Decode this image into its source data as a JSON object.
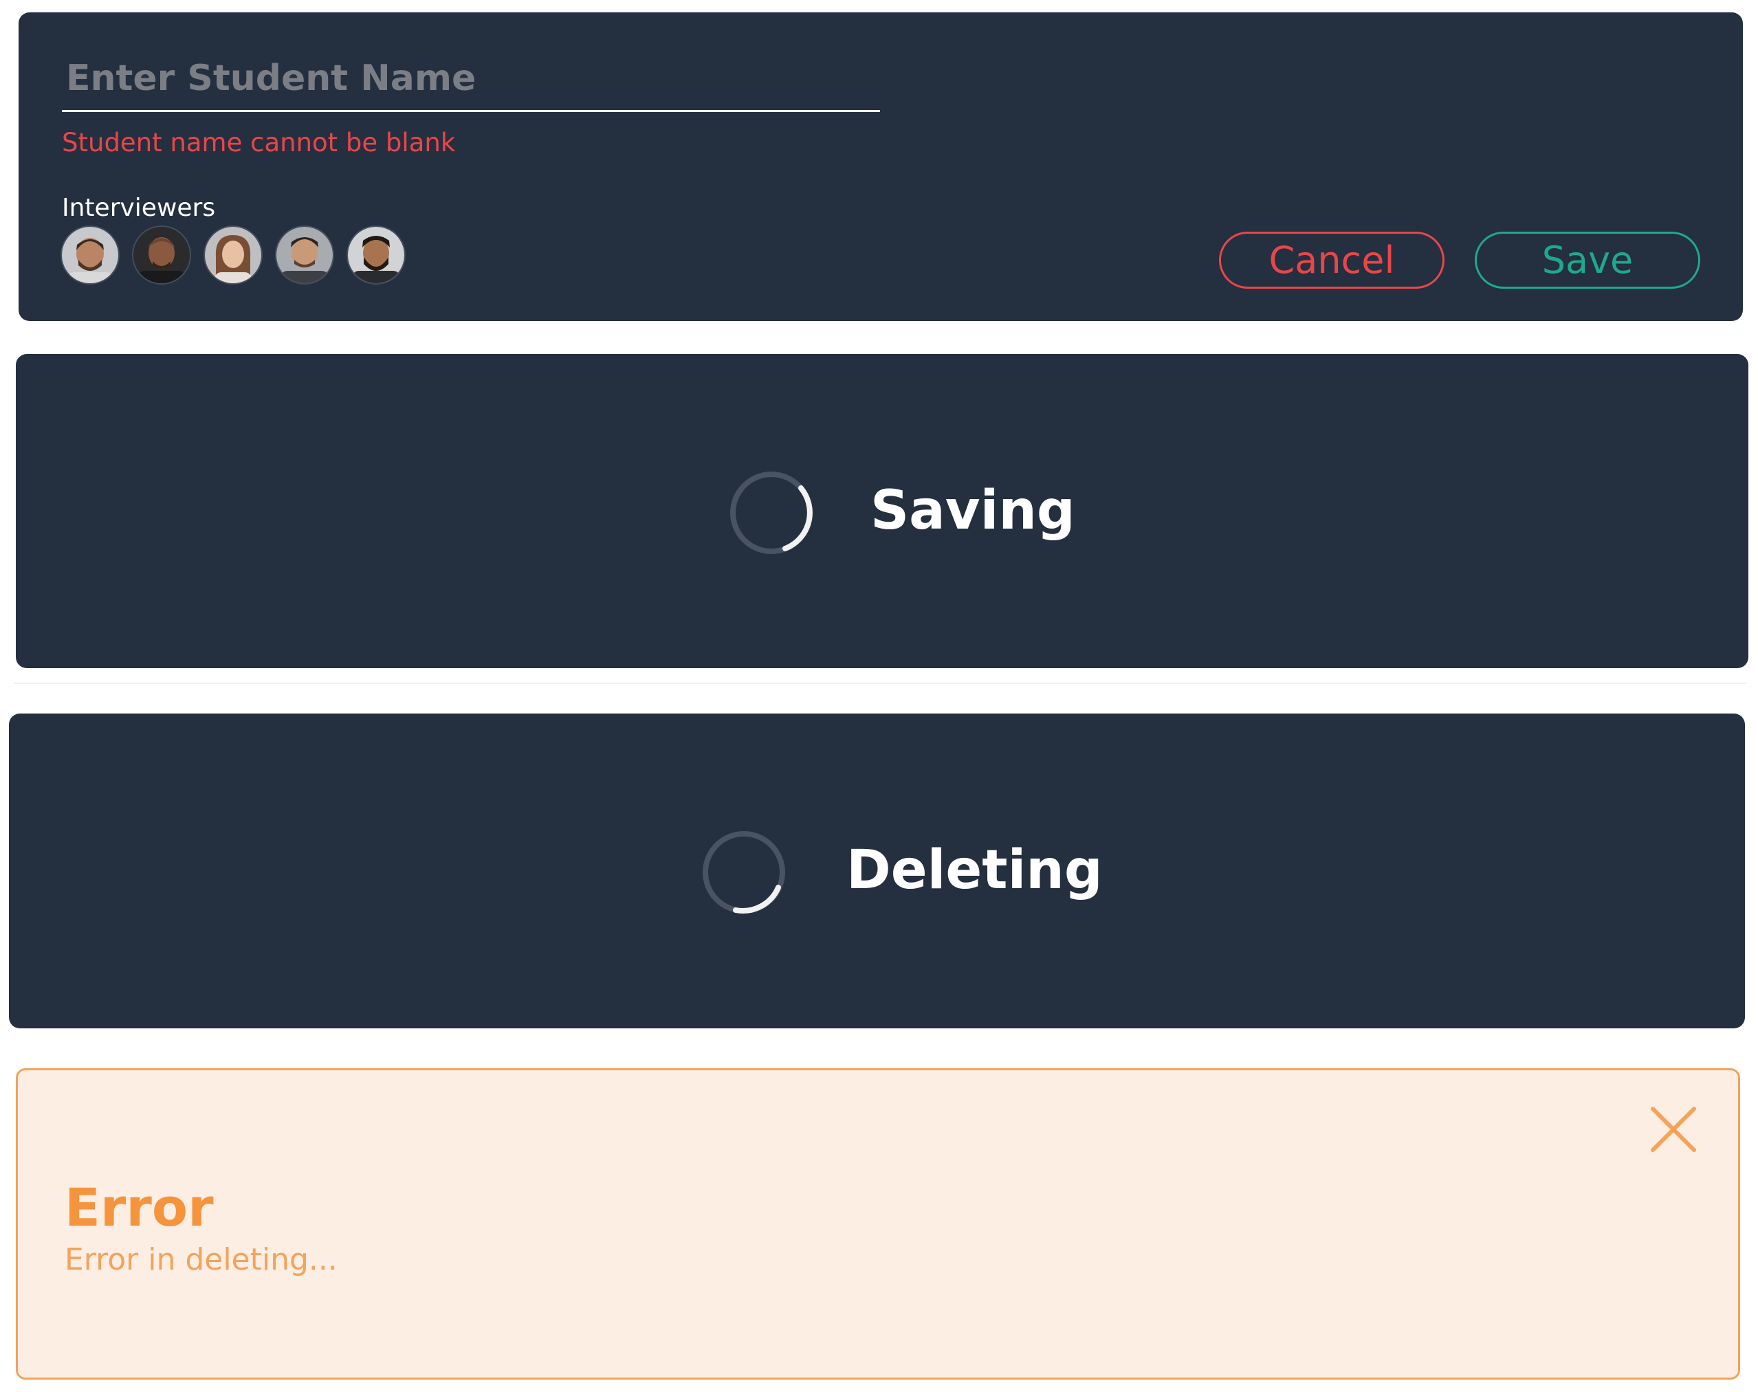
{
  "form": {
    "name_placeholder": "Enter Student Name",
    "name_value": "",
    "validation_error": "Student name cannot be blank",
    "interviewers_label": "Interviewers",
    "interviewers": [
      {
        "icon": "avatar-photo-1"
      },
      {
        "icon": "avatar-photo-2"
      },
      {
        "icon": "avatar-photo-3"
      },
      {
        "icon": "avatar-photo-4"
      },
      {
        "icon": "avatar-photo-5"
      }
    ],
    "cancel_label": "Cancel",
    "save_label": "Save"
  },
  "saving": {
    "label": "Saving",
    "icon": "spinner-icon"
  },
  "deleting": {
    "label": "Deleting",
    "icon": "spinner-icon"
  },
  "error": {
    "title": "Error",
    "message": "Error in deleting...",
    "close_icon": "close-icon"
  },
  "colors": {
    "panel_background": "#242f40",
    "danger": "#e9464a",
    "success": "#1fa98a",
    "warning_text": "#f4953e",
    "warning_background": "#fdeee4",
    "warning_border": "#f4a35a"
  }
}
